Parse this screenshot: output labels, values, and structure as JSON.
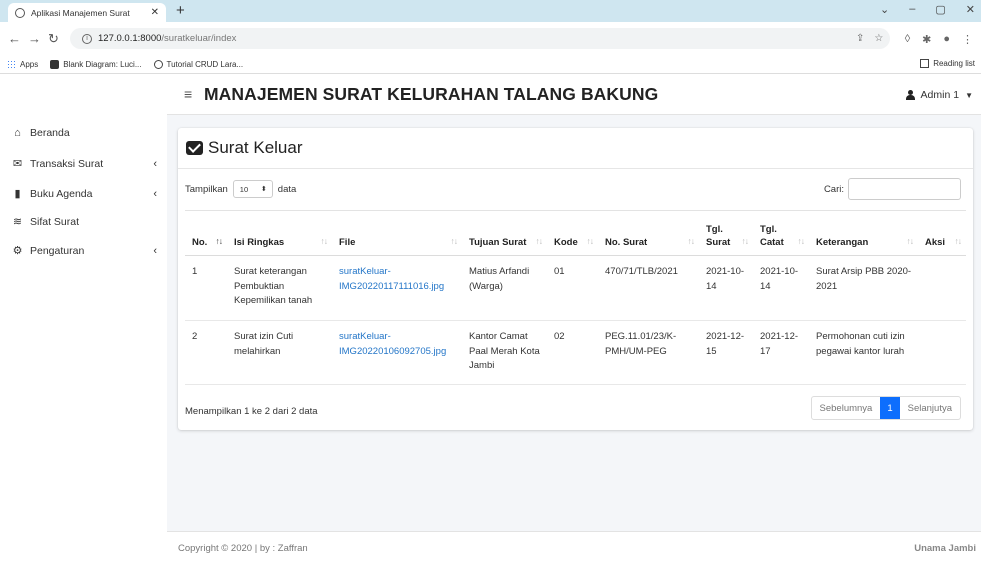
{
  "browser": {
    "tab_title": "Aplikasi Manajemen Surat",
    "url_host": "127.0.0.1:8000",
    "url_path": "/suratkeluar/index",
    "bookmarks": [
      "Apps",
      "Blank Diagram: Luci...",
      "Tutorial CRUD Lara..."
    ],
    "reading_list": "Reading list"
  },
  "app": {
    "title": "MANAJEMEN SURAT KELURAHAN TALANG BAKUNG",
    "user": "Admin 1"
  },
  "sidebar": {
    "items": [
      {
        "label": "Beranda",
        "icon": "home-icon"
      },
      {
        "label": "Transaksi Surat",
        "icon": "mail-bulk-icon"
      },
      {
        "label": "Buku Agenda",
        "icon": "book-icon"
      },
      {
        "label": "Sifat Surat",
        "icon": "layers-icon"
      },
      {
        "label": "Pengaturan",
        "icon": "cogs-icon"
      }
    ]
  },
  "card": {
    "title": "Surat Keluar",
    "length_prefix": "Tampilkan",
    "length_value": "10",
    "length_suffix": "data",
    "search_label": "Cari:",
    "columns": [
      "No.",
      "Isi Ringkas",
      "File",
      "Tujuan Surat",
      "Kode",
      "No. Surat",
      "Tgl. Surat",
      "Tgl. Catat",
      "Keterangan",
      "Aksi"
    ],
    "rows": [
      {
        "no": "1",
        "isi": "Surat keterangan Pembuktian Kepemilikan tanah",
        "file": "suratKeluar-IMG20220117111016.jpg",
        "tujuan": "Matius Arfandi (Warga)",
        "kode": "01",
        "nosurat": "470/71/TLB/2021",
        "tglsurat": "2021-10-14",
        "tglcatat": "2021-10-14",
        "ket": "Surat Arsip PBB 2020-2021",
        "aksi": ""
      },
      {
        "no": "2",
        "isi": "Surat izin Cuti melahirkan",
        "file": "suratKeluar-IMG20220106092705.jpg",
        "tujuan": "Kantor Camat Paal Merah Kota Jambi",
        "kode": "02",
        "nosurat": "PEG.11.01/23/K-PMH/UM-PEG",
        "tglsurat": "2021-12-15",
        "tglcatat": "2021-12-17",
        "ket": "Permohonan cuti izin pegawai kantor lurah",
        "aksi": ""
      }
    ],
    "info": "Menampilkan 1 ke 2 dari 2 data",
    "pager": {
      "prev": "Sebelumnya",
      "current": "1",
      "next": "Selanjutya"
    }
  },
  "footer": {
    "copyright": "Copyright © 2020 | by : Zaffran",
    "brand": "Unama Jambi"
  }
}
